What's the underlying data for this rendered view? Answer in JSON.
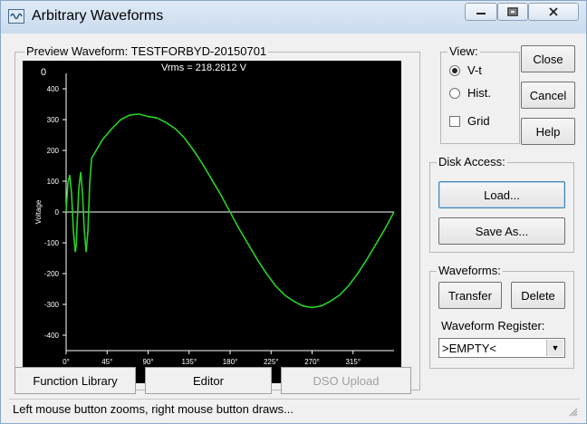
{
  "window": {
    "title": "Arbitrary Waveforms"
  },
  "preview": {
    "label": "Preview Waveform: TESTFORBYD-20150701",
    "rms_text": "Vrms = 218.2812 V",
    "corner_value": "0",
    "ylabel": "Voltage",
    "y_ticks": [
      "400",
      "300",
      "200",
      "100",
      "0",
      "-100",
      "-200",
      "-300",
      "-400"
    ],
    "x_ticks": [
      "0°",
      "45°",
      "90°",
      "135°",
      "180°",
      "225°",
      "270°",
      "315°"
    ]
  },
  "chart_data": {
    "type": "line",
    "xlabel": "",
    "ylabel": "Voltage",
    "xlim": [
      0,
      360
    ],
    "ylim": [
      -450,
      450
    ],
    "x_ticks": [
      0,
      45,
      90,
      135,
      180,
      225,
      270,
      315
    ],
    "y_ticks": [
      400,
      300,
      200,
      100,
      0,
      -100,
      -200,
      -300,
      -400
    ],
    "grid": false,
    "series": [
      {
        "color": "#27d127",
        "x": [
          0,
          2,
          4,
          6,
          8,
          10,
          11,
          12,
          14,
          16,
          18,
          20,
          22,
          24,
          26,
          28,
          30,
          34,
          40,
          50,
          60,
          70,
          80,
          90,
          100,
          110,
          120,
          130,
          140,
          150,
          160,
          170,
          180,
          190,
          200,
          210,
          220,
          230,
          240,
          250,
          260,
          270,
          280,
          290,
          300,
          310,
          320,
          330,
          340,
          350,
          360
        ],
        "y": [
          0,
          95,
          120,
          60,
          -60,
          -130,
          -110,
          -40,
          80,
          130,
          60,
          -60,
          -130,
          -60,
          100,
          175,
          185,
          205,
          235,
          270,
          300,
          315,
          318,
          310,
          305,
          290,
          270,
          240,
          200,
          155,
          105,
          55,
          0,
          -55,
          -105,
          -155,
          -200,
          -240,
          -270,
          -290,
          -305,
          -310,
          -305,
          -290,
          -270,
          -240,
          -200,
          -155,
          -105,
          -55,
          0
        ]
      }
    ]
  },
  "view_group": {
    "label": "View:",
    "vt_label": "V-t",
    "hist_label": "Hist.",
    "grid_label": "Grid",
    "vt_selected": true,
    "grid_checked": false
  },
  "buttons": {
    "close": "Close",
    "cancel": "Cancel",
    "help": "Help",
    "load": "Load...",
    "save_as": "Save As...",
    "transfer": "Transfer",
    "delete": "Delete"
  },
  "disk_group": {
    "label": "Disk Access:"
  },
  "waveforms_group": {
    "label": "Waveforms:",
    "register_label": "Waveform Register:",
    "register_value": ">EMPTY<"
  },
  "tabs": {
    "function_library": "Function Library",
    "editor": "Editor",
    "dso_upload": "DSO Upload"
  },
  "status": {
    "text": "Left mouse button zooms, right mouse button draws..."
  },
  "colors": {
    "trace": "#27d127",
    "plot_bg": "#000000",
    "axis": "#ffffff"
  }
}
